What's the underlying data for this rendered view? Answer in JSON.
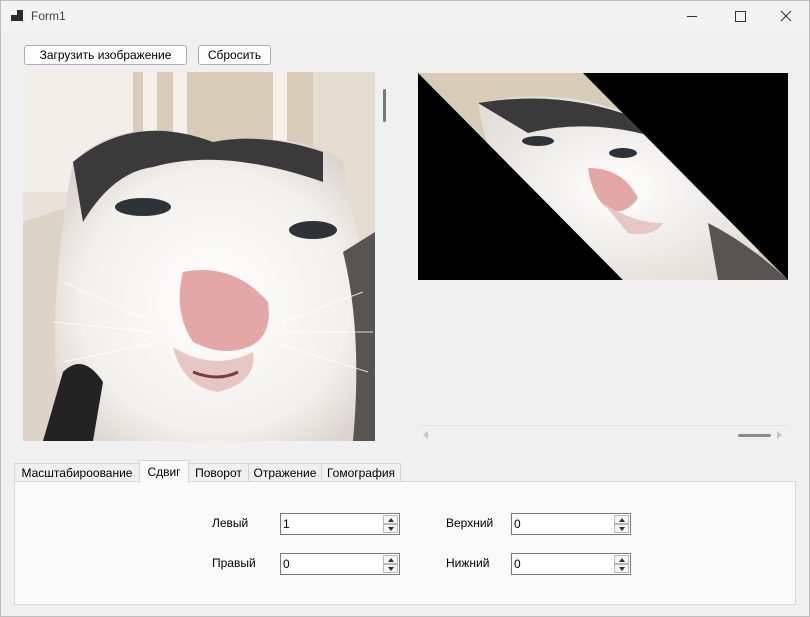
{
  "window": {
    "title": "Form1"
  },
  "toolbar": {
    "load_label": "Загрузить изображение",
    "reset_label": "Сбросить"
  },
  "tabs": [
    {
      "label": "Масштабироование"
    },
    {
      "label": "Сдвиг"
    },
    {
      "label": "Поворот"
    },
    {
      "label": "Отражение"
    },
    {
      "label": "Гомография"
    }
  ],
  "active_tab": "Сдвиг",
  "shear": {
    "left_label": "Левый",
    "left_value": "1",
    "right_label": "Правый",
    "right_value": "0",
    "top_label": "Верхний",
    "top_value": "0",
    "bottom_label": "Нижний",
    "bottom_value": "0"
  },
  "icons": {
    "minimize": "minimize-icon",
    "maximize": "maximize-icon",
    "close": "close-icon",
    "scroll_left": "chevron-left-icon",
    "scroll_right": "chevron-right-icon"
  }
}
